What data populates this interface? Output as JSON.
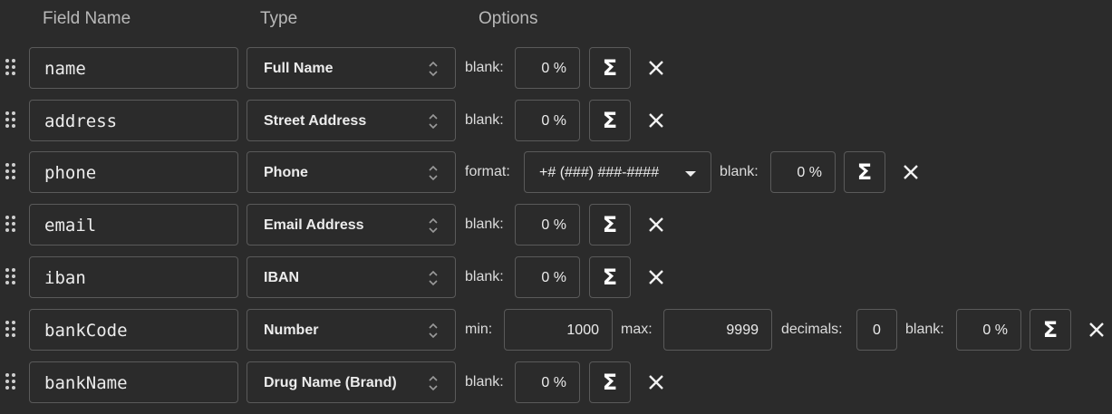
{
  "header": {
    "field_name": "Field Name",
    "type": "Type",
    "options": "Options"
  },
  "icons": {
    "drag": "drag-handle-icon",
    "updown": "chevron-up-down-icon",
    "sigma": "sigma-icon",
    "close": "close-icon",
    "caret": "caret-down-icon"
  },
  "labels": {
    "blank": "blank:",
    "format": "format:",
    "min": "min:",
    "max": "max:",
    "decimals": "decimals:",
    "sigma_glyph": "Σ"
  },
  "rows": [
    {
      "name": "name",
      "type": "Full Name",
      "blank": "0 %"
    },
    {
      "name": "address",
      "type": "Street Address",
      "blank": "0 %"
    },
    {
      "name": "phone",
      "type": "Phone",
      "format": "+# (###) ###-####",
      "blank": "0 %"
    },
    {
      "name": "email",
      "type": "Email Address",
      "blank": "0 %"
    },
    {
      "name": "iban",
      "type": "IBAN",
      "blank": "0 %"
    },
    {
      "name": "bankCode",
      "type": "Number",
      "min": "1000",
      "max": "9999",
      "decimals": "0",
      "blank": "0 %"
    },
    {
      "name": "bankName",
      "type": "Drug Name (Brand)",
      "blank": "0 %"
    }
  ]
}
